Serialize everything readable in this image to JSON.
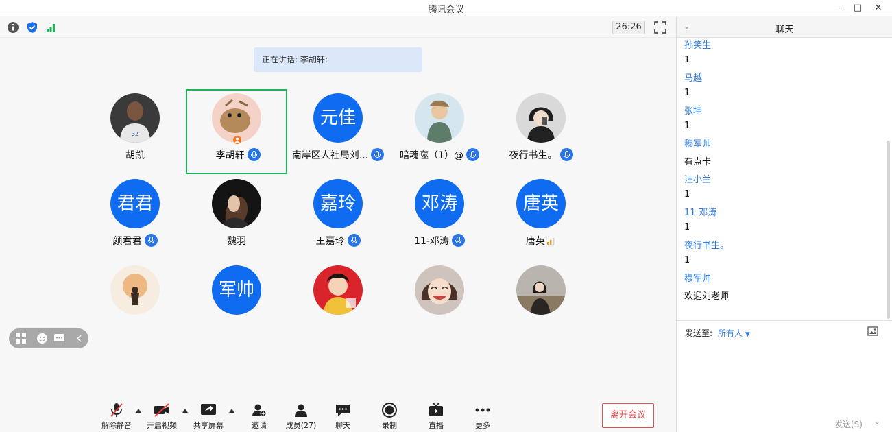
{
  "window": {
    "title": "腾讯会议"
  },
  "toolbar": {
    "timer": "26:26"
  },
  "speaking": {
    "text": "正在讲话: 李胡轩;"
  },
  "participants": [
    {
      "name": "胡凯",
      "avatar_text": "",
      "mic": false,
      "active": false
    },
    {
      "name": "李胡轩",
      "avatar_text": "",
      "mic": true,
      "active": true
    },
    {
      "name": "南岸区人社局刘...",
      "avatar_text": "元佳",
      "mic": true,
      "active": false
    },
    {
      "name": "暗魂噬（1）@",
      "avatar_text": "",
      "mic": true,
      "active": false
    },
    {
      "name": "夜行书生。",
      "avatar_text": "",
      "mic": true,
      "active": false
    },
    {
      "name": "颜君君",
      "avatar_text": "君君",
      "mic": true,
      "active": false
    },
    {
      "name": "魏羽",
      "avatar_text": "",
      "mic": false,
      "active": false
    },
    {
      "name": "王嘉玲",
      "avatar_text": "嘉玲",
      "mic": true,
      "active": false
    },
    {
      "name": "11-邓涛",
      "avatar_text": "邓涛",
      "mic": true,
      "active": false
    },
    {
      "name": "唐英",
      "avatar_text": "唐英",
      "mic": false,
      "active": false
    },
    {
      "name": "",
      "avatar_text": "",
      "mic": false,
      "active": false
    },
    {
      "name": "",
      "avatar_text": "军帅",
      "mic": false,
      "active": false
    },
    {
      "name": "",
      "avatar_text": "",
      "mic": false,
      "active": false
    },
    {
      "name": "",
      "avatar_text": "",
      "mic": false,
      "active": false
    },
    {
      "name": "",
      "avatar_text": "",
      "mic": false,
      "active": false
    }
  ],
  "bottombar": {
    "unmute": "解除静音",
    "video": "开启视频",
    "share": "共享屏幕",
    "invite": "邀请",
    "members": "成员(27)",
    "chat": "聊天",
    "record": "录制",
    "live": "直播",
    "more": "更多",
    "leave": "离开会议"
  },
  "chat": {
    "title": "聊天",
    "messages": [
      {
        "sender": "孙笑生",
        "text": "1"
      },
      {
        "sender": "马越",
        "text": "1"
      },
      {
        "sender": "张坤",
        "text": "1"
      },
      {
        "sender": "穆军帅",
        "text": "有点卡"
      },
      {
        "sender": "汪小兰",
        "text": "1"
      },
      {
        "sender": " 11-邓涛",
        "text": "1"
      },
      {
        "sender": "夜行书生。",
        "text": "1"
      },
      {
        "sender": "穆军帅",
        "text": "欢迎刘老师"
      }
    ],
    "send_to_label": "发送至:",
    "send_to_value": "所有人",
    "send_button": "发送(S)"
  }
}
